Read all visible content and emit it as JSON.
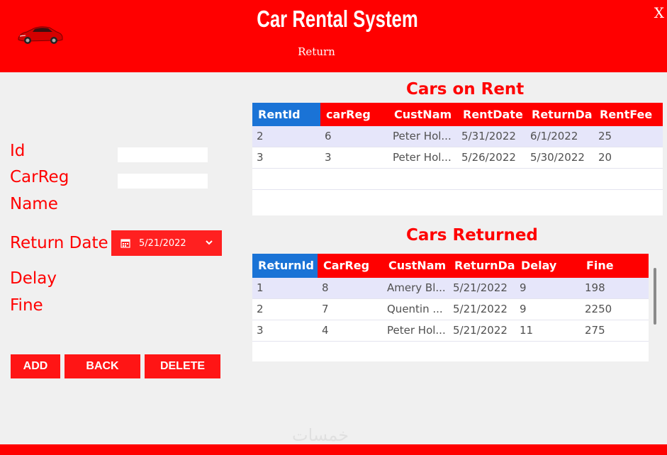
{
  "header": {
    "title": "Car Rental System",
    "subtitle": "Return",
    "close_label": "X",
    "logo_icon": "red-sports-car-icon"
  },
  "form": {
    "id_label": "Id",
    "carreg_label": "CarReg",
    "name_label": "Name",
    "return_date_label": "Return Date",
    "delay_label": "Delay",
    "fine_label": "Fine",
    "id_value": "",
    "carreg_value": "",
    "return_date_value": "5/21/2022"
  },
  "buttons": {
    "add": "ADD",
    "back": "BACK",
    "delete": "DELETE"
  },
  "rent_table": {
    "title": "Cars on Rent",
    "columns": [
      "RentId",
      "carReg",
      "CustNam",
      "RentDate",
      "ReturnDa",
      "RentFee"
    ],
    "rows": [
      [
        "2",
        "6",
        "Peter Hol...",
        "5/31/2022",
        "6/1/2022",
        "25"
      ],
      [
        "3",
        "3",
        "Peter Hol...",
        "5/26/2022",
        "5/30/2022",
        "20"
      ]
    ]
  },
  "return_table": {
    "title": "Cars Returned",
    "columns": [
      "ReturnId",
      "CarReg",
      "CustNam",
      "ReturnDa",
      "Delay",
      "Fine"
    ],
    "rows": [
      [
        "1",
        "8",
        "Amery Bl...",
        "5/21/2022",
        "9",
        "198"
      ],
      [
        "2",
        "7",
        "Quentin ...",
        "5/21/2022",
        "9",
        "2250"
      ],
      [
        "3",
        "4",
        "Peter Hol...",
        "5/21/2022",
        "11",
        "275"
      ]
    ]
  },
  "watermark": "خمسات",
  "colors": {
    "accent": "#ff0000",
    "header_first_col": "#1a73d6",
    "selected_row": "#e6e6fa"
  }
}
